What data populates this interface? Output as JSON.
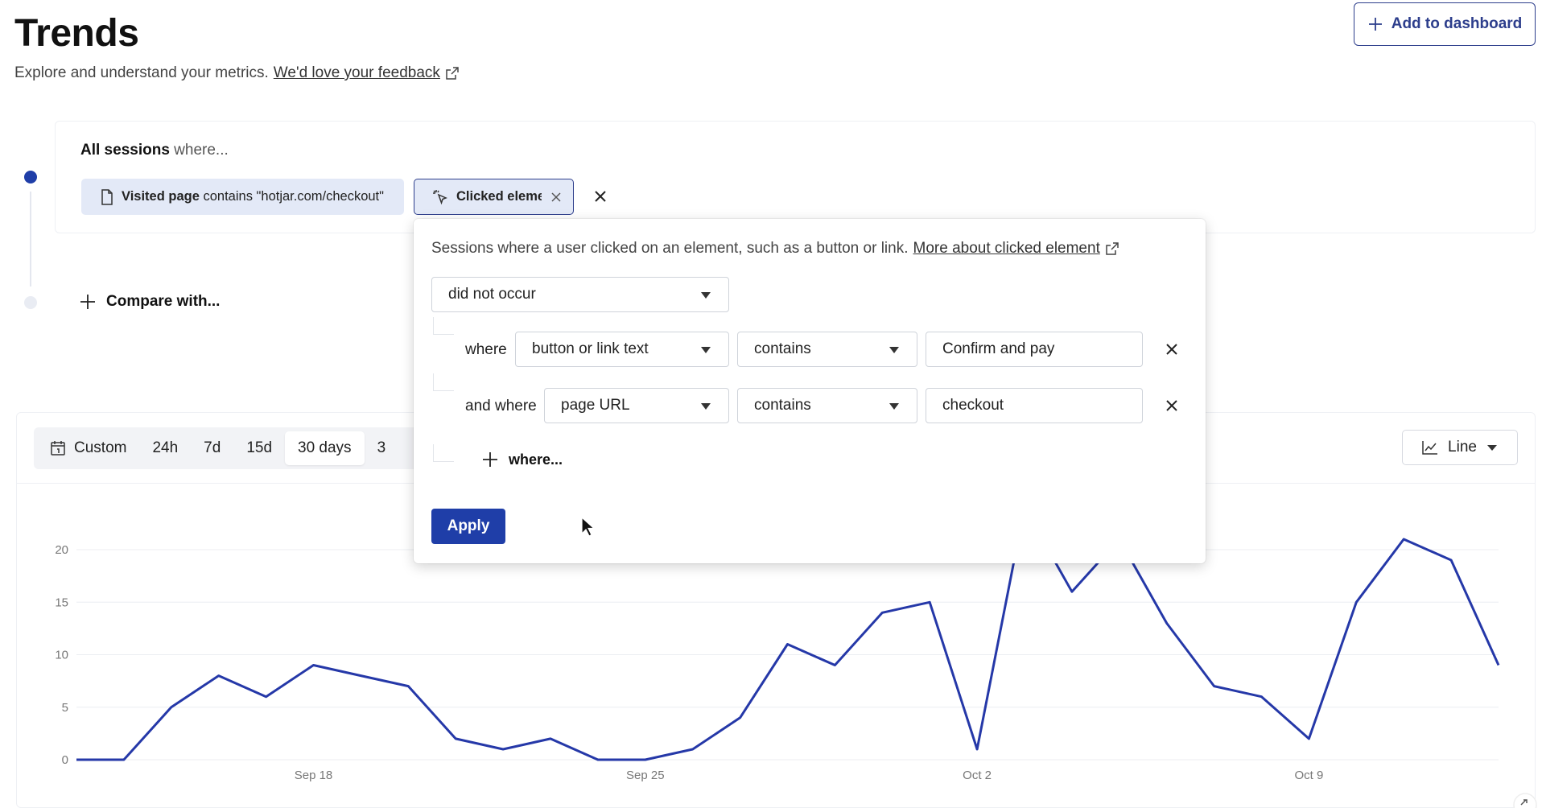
{
  "header": {
    "title": "Trends",
    "subtitle": "Explore and understand your metrics.",
    "feedback_link": "We'd love your feedback",
    "add_dashboard_label": "Add to dashboard"
  },
  "filters": {
    "heading_bold": "All sessions",
    "heading_rest": "where...",
    "visited_chip": {
      "label_bold": "Visited page",
      "label_rest": "contains \"hotjar.com/checkout\""
    },
    "clicked_chip": {
      "label": "Clicked eleme"
    },
    "compare_label": "Compare with..."
  },
  "range": {
    "items": [
      "Custom",
      "24h",
      "7d",
      "15d",
      "30 days",
      "3"
    ],
    "active": "30 days"
  },
  "chart_type": {
    "label": "Line"
  },
  "popover": {
    "description": "Sessions where a user clicked on an element, such as a button or link.",
    "more_link": "More about clicked element",
    "occurrence_select": "did not occur",
    "rows": [
      {
        "label": "where",
        "field": "button or link text",
        "operator": "contains",
        "value": "Confirm and pay"
      },
      {
        "label": "and where",
        "field": "page URL",
        "operator": "contains",
        "value": "checkout"
      }
    ],
    "add_where_label": "where...",
    "apply_label": "Apply"
  },
  "colors": {
    "accent": "#1f3ea8",
    "chip_bg": "#e3e9f7",
    "line": "#2538a8"
  },
  "chart_data": {
    "type": "line",
    "yticks": [
      "0",
      "5",
      "10",
      "15",
      "20"
    ],
    "ylim": [
      0,
      20
    ],
    "xtick_labels": [
      "Sep 18",
      "Sep 25",
      "Oct 2",
      "Oct 9"
    ],
    "xtick_days": [
      5,
      12,
      19,
      26
    ],
    "x_days": [
      0,
      1,
      2,
      3,
      4,
      5,
      6,
      7,
      8,
      9,
      10,
      11,
      12,
      13,
      14,
      15,
      16,
      17,
      18,
      19,
      20,
      21,
      22,
      23,
      24,
      25,
      26,
      27,
      28,
      29,
      30
    ],
    "values": [
      0,
      0,
      5,
      8,
      6,
      9,
      8,
      7,
      2,
      1,
      2,
      0,
      0,
      1,
      4,
      11,
      9,
      14,
      15,
      1,
      24,
      16,
      21,
      13,
      7,
      6,
      2,
      15,
      21,
      19,
      9
    ]
  }
}
